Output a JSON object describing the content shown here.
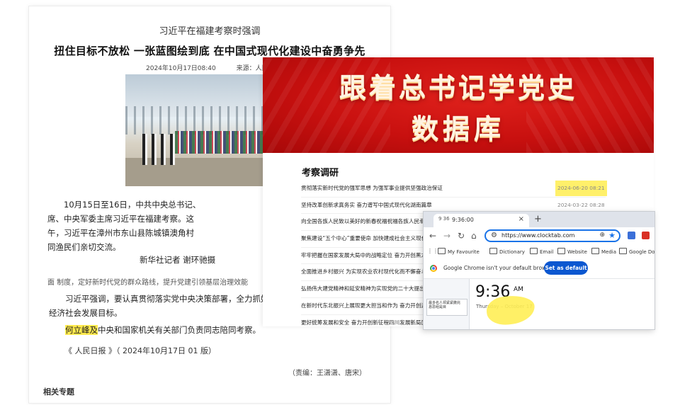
{
  "article": {
    "kicker": "习近平在福建考察时强调",
    "title": "扭住目标不放松 一张蓝图绘到底 在中国式现代化建设中奋勇争先",
    "date": "2024年10月17日08:40",
    "source": "来源：人民网－人民",
    "body_lines": [
      "　　10月15日至16日，中共中央总书记、",
      "席、中央军委主席习近平在福建考察。这",
      "午，习近平在漳州市东山县陈城镇澳角村",
      "同渔民们亲切交流。"
    ],
    "photo_credit": "新华社记者 谢环驰摄",
    "cut_line": "面  制度，定好新时代党的群众路线，提升党建引领基层治理效能",
    "body2_prefix": "　　习近平强调，要认真贯彻落实党中央决策部署，全力抓好第四",
    "body2_line2": "经济社会发展目标。",
    "highlight_name": "何立峰及",
    "body3_rest": "中央和国家机关有关部门负责同志陪同考察。",
    "paper_source": "《 人民日报 》（ 2024年10月17日 01 版）",
    "editor": "（责编：王潇潇、唐宋）",
    "related": "相关专题"
  },
  "database": {
    "banner_line1": "跟着总书记学党史",
    "banner_line2": "数据库",
    "section_title": "考察调研",
    "items": [
      {
        "title": "贯彻落实新时代党的强军思想 为强军事业提供坚强政治保证",
        "date": "2024-06-20 08:21",
        "highlight": true
      },
      {
        "title": "坚持改革创新求真务实 奋力谱写中国式现代化湖南篇章",
        "date": "2024-03-22 08:28",
        "highlight": false
      },
      {
        "title": "向全国各族人民致以美好的新春祝福祝福各族人民幸福安康",
        "date": "",
        "highlight": false
      },
      {
        "title": "聚焦建设“五个中心”重要使命 加快建成社会主义现代化",
        "date": "",
        "highlight": false
      },
      {
        "title": "牢牢把握在国家发展大局中的战略定位 奋力开创黑龙江",
        "date": "",
        "highlight": false
      },
      {
        "title": "全面推进乡村振兴 为实现农业农村现代化而不懈奋斗",
        "date": "",
        "highlight": false
      },
      {
        "title": "弘扬伟大建党精神和延安精神为实现党的二十大提出的",
        "date": "",
        "highlight": false
      },
      {
        "title": "在新时代东北振兴上展现更大担当和作为 奋力开创辽宁",
        "date": "",
        "highlight": false
      },
      {
        "title": "更好统筹发展和安全 奋力开创新征程四川发展新局面",
        "date": "",
        "highlight": false
      }
    ]
  },
  "chrome": {
    "tab_favicon": "9 36",
    "tab_title": "9:36:00",
    "tab_close": "×",
    "new_tab": "+",
    "url": "https://www.clocktab.com",
    "bookmarks": [
      "My Favourite",
      "Dictionary",
      "Email",
      "Website",
      "Media",
      "Google Docs"
    ],
    "infobar_text": "Google Chrome isn't your default browser",
    "set_default_label": "Set as default",
    "sidebar_line1": "最多名人领紧紧撒兆",
    "sidebar_line2": "恳思组是目",
    "time": "9:36",
    "ampm": "AM",
    "date": "Thursday – October 17",
    "colors": {
      "accent": "#1a73e8",
      "button": "#0b57d0"
    }
  },
  "icons": [
    "back-arrow-icon",
    "forward-arrow-icon",
    "reload-icon",
    "home-icon",
    "tune-icon",
    "zoom-icon",
    "star-icon",
    "folder-icon",
    "chrome-logo-icon"
  ]
}
